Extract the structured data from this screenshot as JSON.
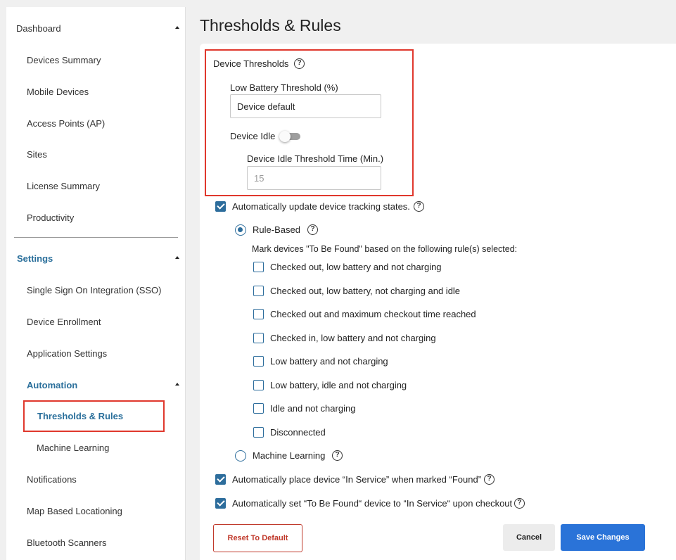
{
  "page_title": "Thresholds & Rules",
  "sidebar": {
    "dashboard": "Dashboard",
    "dashboard_items": [
      "Devices Summary",
      "Mobile Devices",
      "Access Points (AP)",
      "Sites",
      "License Summary",
      "Productivity"
    ],
    "settings": "Settings",
    "settings_items": [
      "Single Sign On Integration (SSO)",
      "Device Enrollment",
      "Application Settings"
    ],
    "automation": "Automation",
    "automation_items": [
      "Thresholds & Rules",
      "Machine Learning"
    ],
    "other_items": [
      "Notifications",
      "Map Based Locationing",
      "Bluetooth Scanners"
    ],
    "active_item": "Thresholds & Rules",
    "colors": {
      "section": "#2a6f9b",
      "highlight": "#e0382d"
    }
  },
  "device_thresholds": {
    "title": "Device Thresholds",
    "low_battery_label": "Low Battery Threshold (%)",
    "low_battery_value": "Device default",
    "device_idle_label": "Device Idle",
    "device_idle_enabled": false,
    "idle_time_label": "Device Idle Threshold Time (Min.)",
    "idle_time_value": "15"
  },
  "auto_update": {
    "label": "Automatically update device tracking states.",
    "checked": true,
    "rule_based_label": "Rule-Based",
    "rule_based_selected": true,
    "rules_description": "Mark devices \"To Be Found\" based on the following rule(s) selected:",
    "rules": [
      "Checked out, low battery and not charging",
      "Checked out, low battery, not charging and idle",
      "Checked out and maximum checkout time reached",
      "Checked in, low battery and not charging",
      "Low battery and not charging",
      "Low battery, idle and not charging",
      "Idle and not charging",
      "Disconnected"
    ],
    "machine_learning_label": "Machine Learning"
  },
  "auto_in_service_found": {
    "label": "Automatically place device “In Service” when marked “Found”",
    "checked": true
  },
  "auto_in_service_checkout": {
    "label": "Automatically set “To Be Found“ device to “In Service“ upon checkout",
    "checked": true
  },
  "buttons": {
    "reset": "Reset To Default",
    "cancel": "Cancel",
    "save": "Save Changes"
  },
  "help_glyph": "?",
  "colors": {
    "accent": "#2d6d9c",
    "primary_button": "#2a73d8",
    "danger": "#c0392b"
  }
}
